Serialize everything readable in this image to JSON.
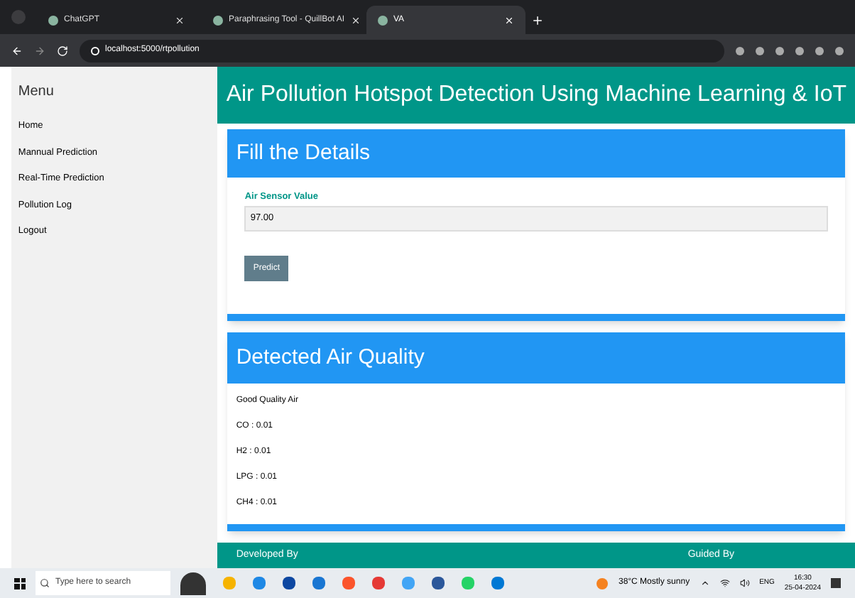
{
  "browser": {
    "tabs": [
      {
        "title": "ChatGPT",
        "selected": false
      },
      {
        "title": "Paraphrasing Tool - QuillBot AI",
        "selected": false
      },
      {
        "title": "VA",
        "selected": true
      }
    ],
    "url": "localhost:5000/rtpollution"
  },
  "sidebar": {
    "title": "Menu",
    "items": [
      {
        "label": "Home"
      },
      {
        "label": "Mannual Prediction"
      },
      {
        "label": "Real-Time Prediction"
      },
      {
        "label": "Pollution Log"
      },
      {
        "label": "Logout"
      }
    ]
  },
  "header": {
    "title": "Air Pollution Hotspot Detection Using Machine Learning & IoT"
  },
  "form_card": {
    "title": "Fill the Details",
    "field_label": "Air Sensor Value",
    "field_value": "97.00",
    "button": "Predict"
  },
  "result_card": {
    "title": "Detected Air Quality",
    "lines": [
      "Good Quality Air",
      "CO : 0.01",
      "H2 : 0.01",
      "LPG : 0.01",
      "CH4 : 0.01"
    ]
  },
  "footer": {
    "left": "Developed By",
    "right": "Guided By"
  },
  "taskbar": {
    "search_placeholder": "Type here to search",
    "weather": "38°C  Mostly sunny",
    "language": "ENG",
    "time": "16:30",
    "date": "25-04-2024"
  }
}
